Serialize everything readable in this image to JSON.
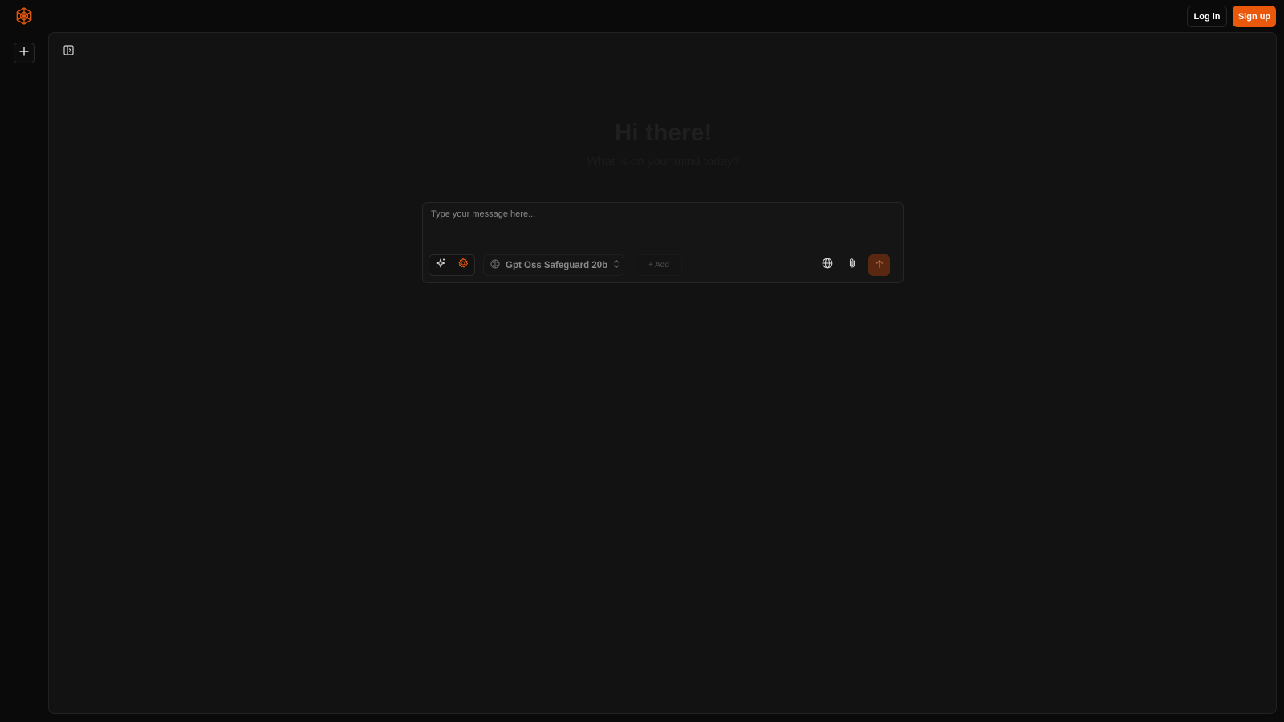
{
  "header": {
    "logo_icon": "hexagon-logo-icon",
    "login_label": "Log in",
    "signup_label": "Sign up",
    "accent_color": "#ea580c"
  },
  "rail": {
    "new_chat_icon": "plus-icon"
  },
  "main": {
    "sidebar_toggle_icon": "sidebar-toggle-icon",
    "greeting_title": "Hi there!",
    "greeting_subtitle": "What is on your mind today?"
  },
  "composer": {
    "placeholder": "Type your message here...",
    "value": "",
    "mode_icons": [
      "sparkles-icon",
      "gear-icon"
    ],
    "model": {
      "label": "Gpt Oss Safeguard 20b",
      "icon": "model-icon",
      "chevron_icon": "chevrons-up-down-icon"
    },
    "add_label": "+ Add",
    "web_search_icon": "globe-icon",
    "attach_icon": "paperclip-icon",
    "send_icon": "arrow-up-icon"
  }
}
